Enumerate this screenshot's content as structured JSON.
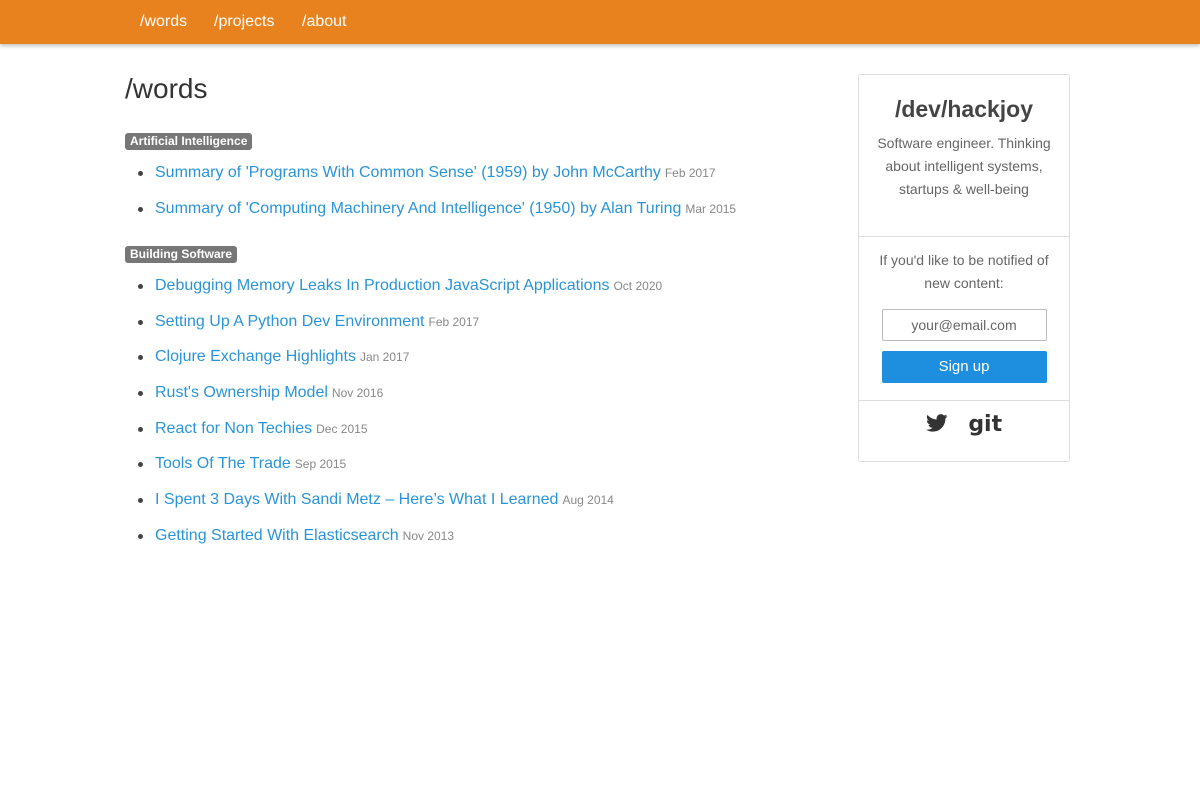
{
  "nav": {
    "items": [
      {
        "label": "/words"
      },
      {
        "label": "/projects"
      },
      {
        "label": "/about"
      }
    ]
  },
  "main": {
    "title": "/words",
    "sections": [
      {
        "tag": "Artificial Intelligence",
        "posts": [
          {
            "title": "Summary of 'Programs With Common Sense' (1959) by John McCarthy",
            "date": "Feb 2017"
          },
          {
            "title": "Summary of 'Computing Machinery And Intelligence' (1950) by Alan Turing",
            "date": "Mar 2015"
          }
        ]
      },
      {
        "tag": "Building Software",
        "posts": [
          {
            "title": "Debugging Memory Leaks In Production JavaScript Applications",
            "date": "Oct 2020"
          },
          {
            "title": "Setting Up A Python Dev Environment",
            "date": "Feb 2017"
          },
          {
            "title": "Clojure Exchange Highlights",
            "date": "Jan 2017"
          },
          {
            "title": "Rust's Ownership Model",
            "date": "Nov 2016"
          },
          {
            "title": "React for Non Techies",
            "date": "Dec 2015"
          },
          {
            "title": "Tools Of The Trade",
            "date": "Sep 2015"
          },
          {
            "title": "I Spent 3 Days With Sandi Metz – Here’s What I Learned",
            "date": "Aug 2014"
          },
          {
            "title": "Getting Started With Elasticsearch",
            "date": "Nov 2013"
          }
        ]
      }
    ]
  },
  "sidebar": {
    "title": "/dev/hackjoy",
    "description": "Software engineer. Thinking about intelligent systems, startups & well-being",
    "notify_text": "If you'd like to be notified of new content:",
    "email_placeholder": "your@email.com",
    "signup_label": "Sign up",
    "social": {
      "twitter_icon": "twitter-icon",
      "git_icon": "git-icon",
      "git_label": "git"
    }
  },
  "colors": {
    "navbar": "#e8821e",
    "link": "#2a94d6",
    "tag_bg": "#777777",
    "button": "#1e8ede"
  }
}
